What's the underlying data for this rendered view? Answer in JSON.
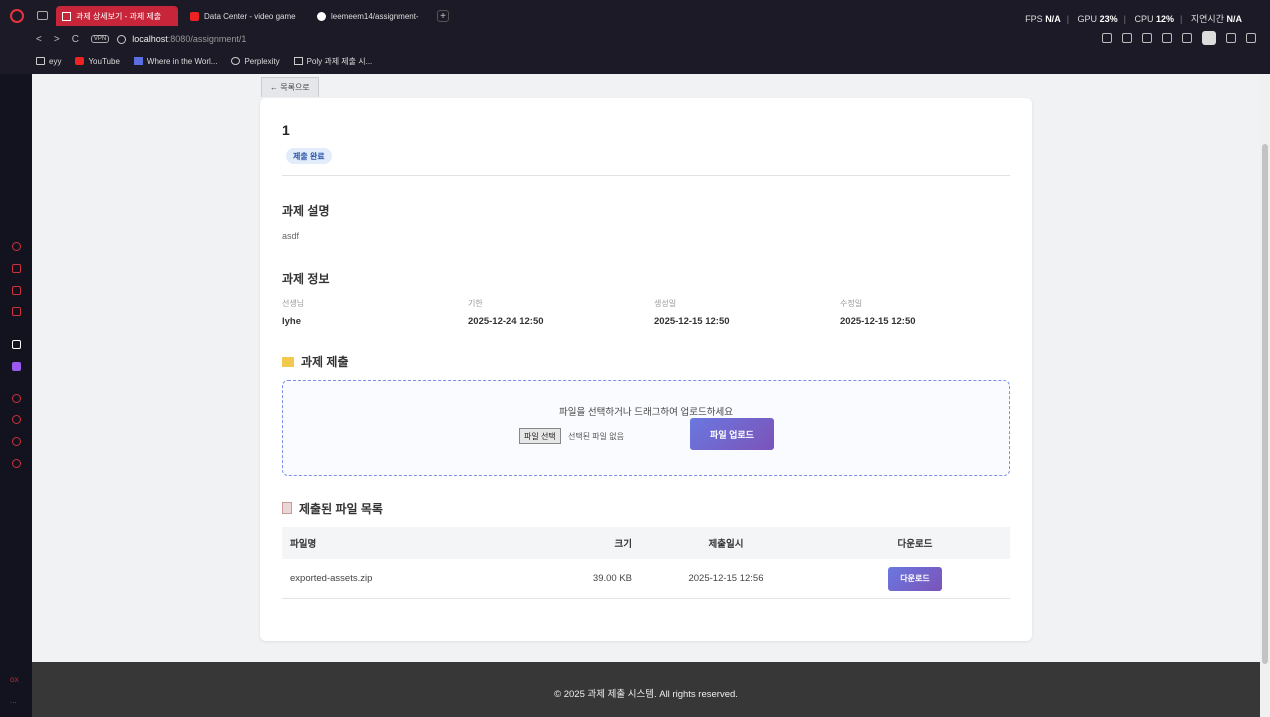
{
  "browser": {
    "tabs": [
      {
        "label": "과제 상세보기 - 과제 제출",
        "active": true
      },
      {
        "label": "Data Center - video game",
        "active": false
      },
      {
        "label": "leemeem14/assignment-",
        "active": false
      }
    ],
    "stats": {
      "fps_label": "FPS",
      "fps_value": "N/A",
      "gpu_label": "GPU",
      "gpu_value": "23%",
      "cpu_label": "CPU",
      "cpu_value": "12%",
      "latency_label": "지연시간",
      "latency_value": "N/A"
    },
    "vpn_label": "VPN",
    "url_host": "localhost",
    "url_path": ":8080/assignment/1",
    "bookmarks": [
      "eyy",
      "YouTube",
      "Where in the Worl...",
      "Perplexity",
      "Poly 과제 제출 시..."
    ],
    "sidebar_gx": "GX",
    "sidebar_more": "..."
  },
  "page": {
    "back_label": "← 목록으로",
    "assignment_title": "1",
    "status_badge": "제출 완료",
    "description_heading": "과제 설명",
    "description": "asdf",
    "info_heading": "과제 정보",
    "info": [
      {
        "label": "선생님",
        "value": "lyhe"
      },
      {
        "label": "기한",
        "value": "2025-12-24 12:50"
      },
      {
        "label": "생성일",
        "value": "2025-12-15 12:50"
      },
      {
        "label": "수정일",
        "value": "2025-12-15 12:50"
      }
    ],
    "submit_heading": "과제 제출",
    "dropzone_text": "파일을 선택하거나 드래그하여 업로드하세요",
    "file_choose_label": "파일 선택",
    "file_none_label": "선택된 파일 없음",
    "upload_button": "파일 업로드",
    "files_heading": "제출된 파일 목록",
    "table_headers": [
      "파일명",
      "크기",
      "제출일시",
      "다운로드"
    ],
    "files": [
      {
        "name": "exported-assets.zip",
        "size": "39.00 KB",
        "submitted": "2025-12-15 12:56",
        "action": "다운로드"
      }
    ],
    "footer": "© 2025 과제 제출 시스템. All rights reserved."
  },
  "colors": {
    "accent_start": "#6a78e0",
    "accent_end": "#7b53b8",
    "badge_bg": "#e3ecfa",
    "badge_text": "#2b54a8",
    "opera_red": "#c7263a"
  }
}
